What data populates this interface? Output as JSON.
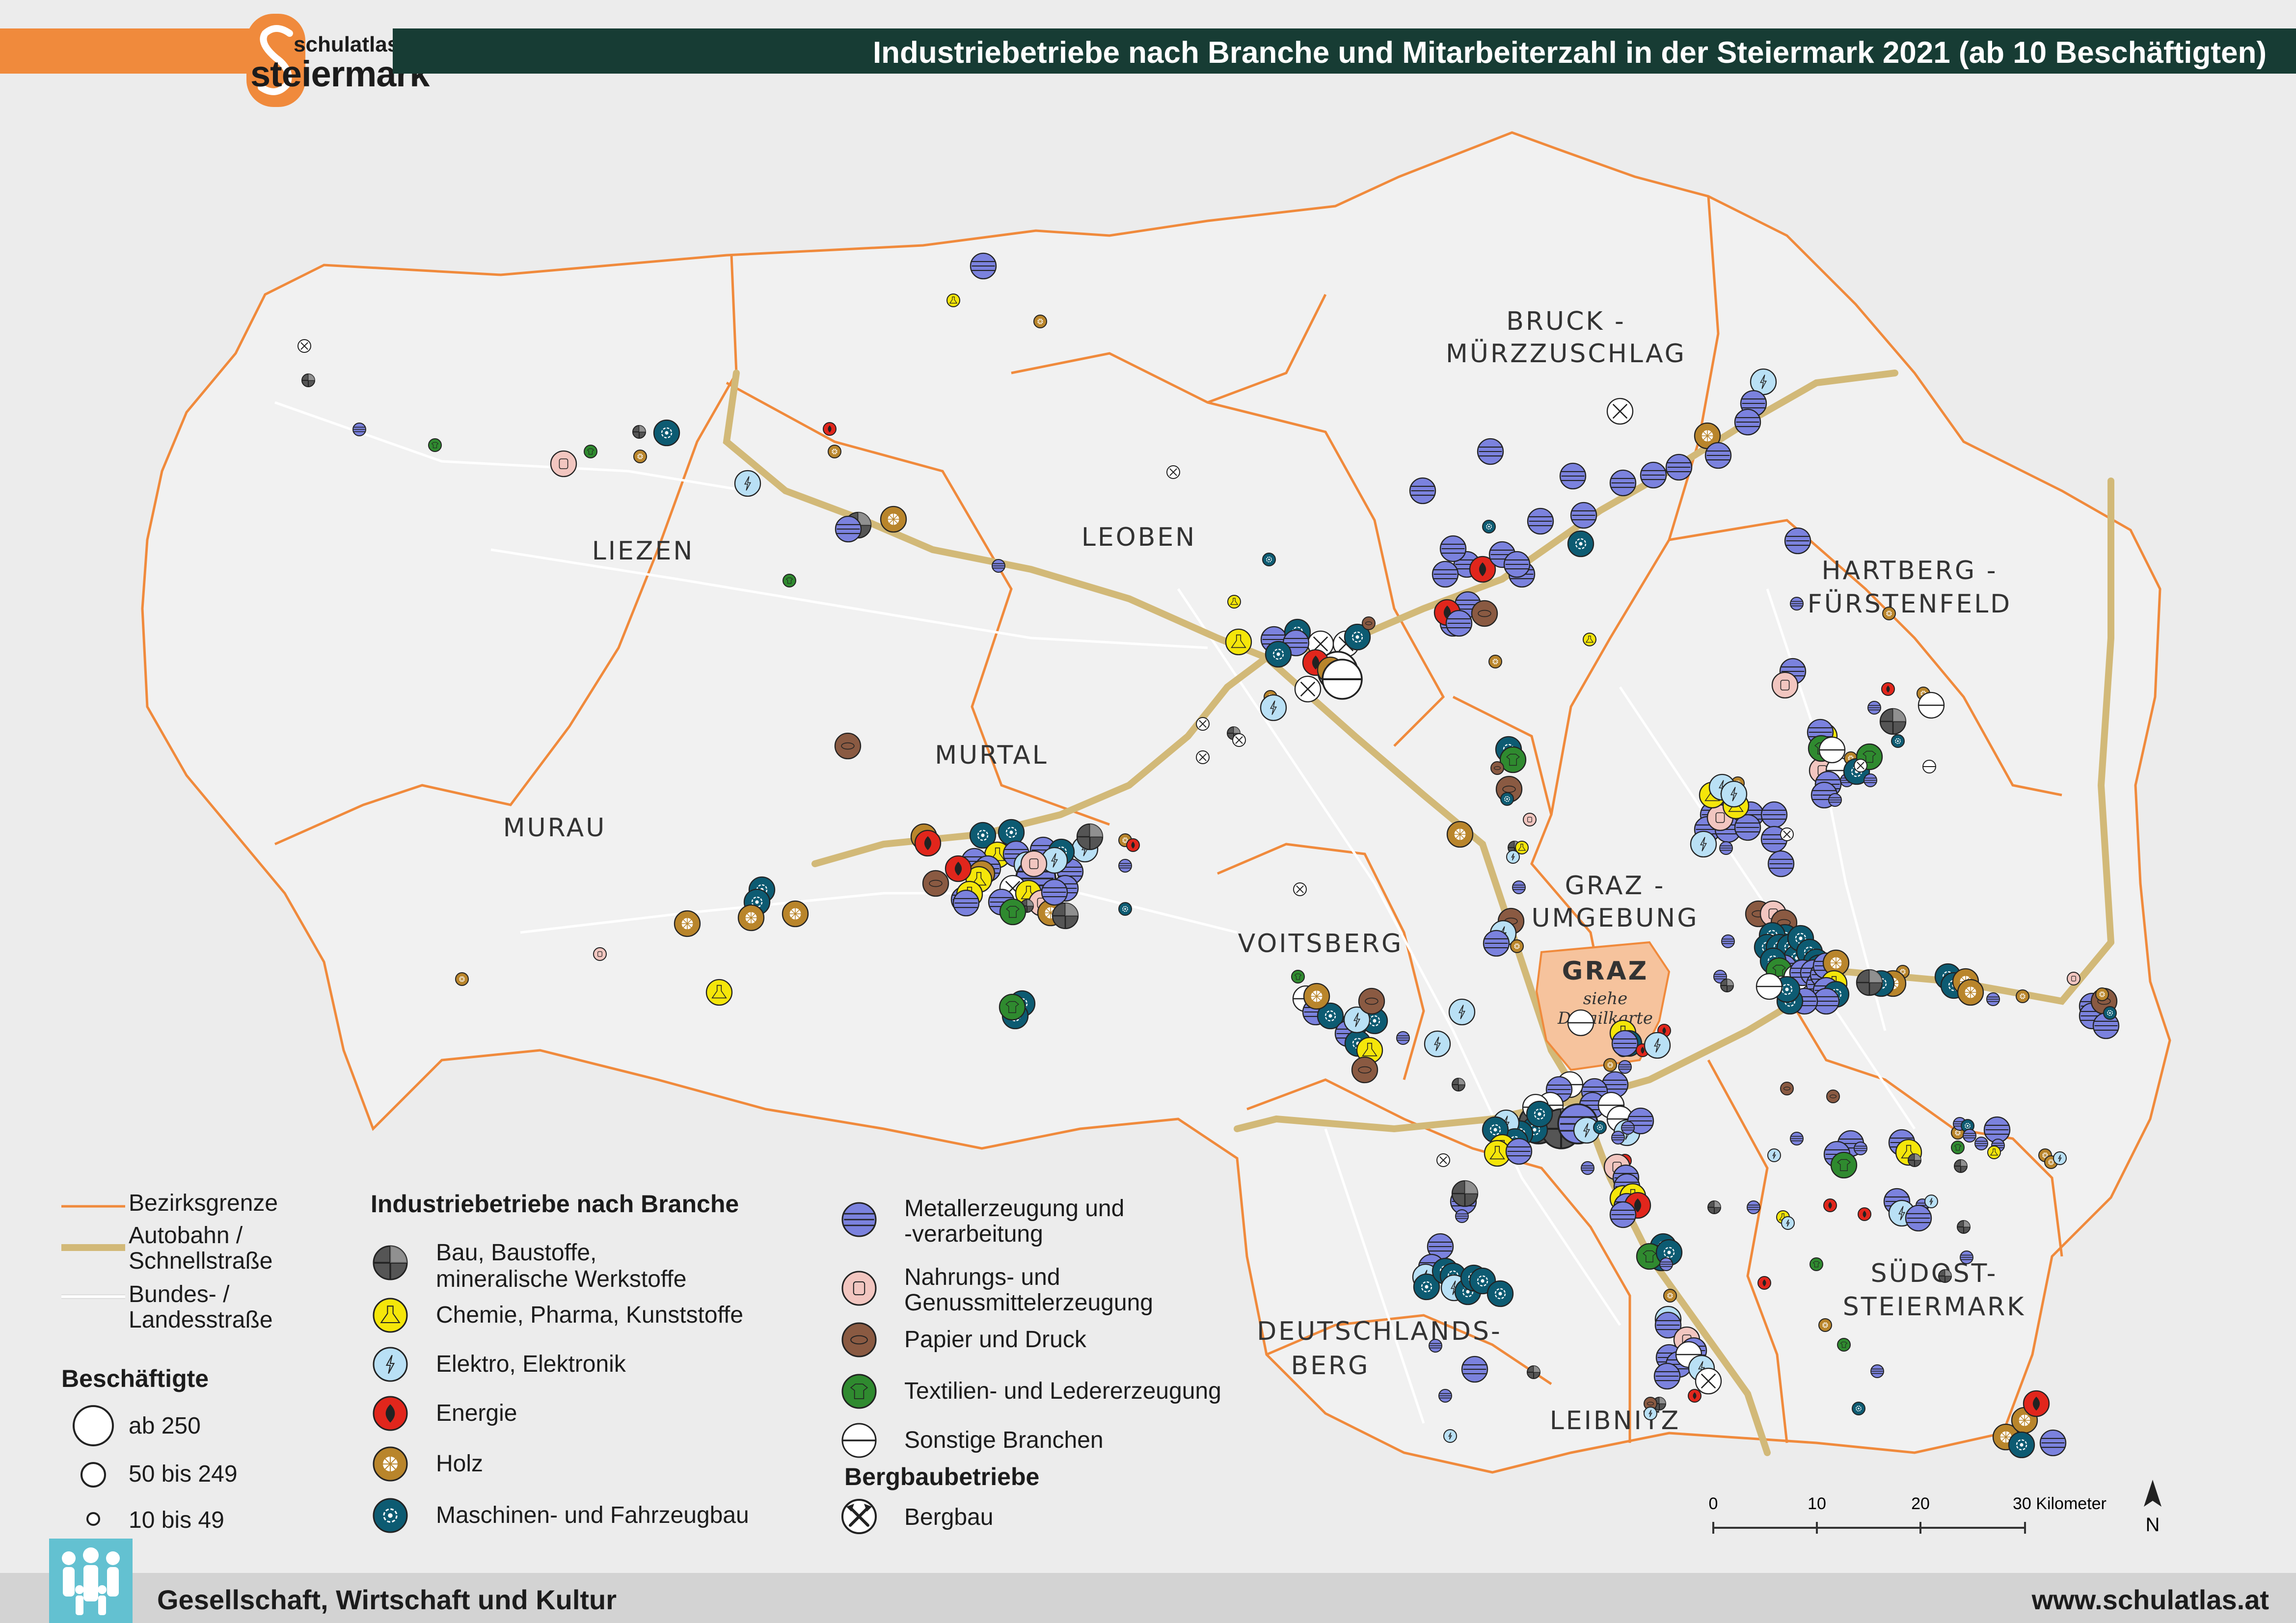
{
  "header": {
    "logo_top": "schulatlas",
    "logo_main": "steiermark",
    "title": "Industriebetriebe nach Branche und Mitarbeiterzahl in der Steiermark 2021 (ab 10 Beschäftigten)"
  },
  "colors": {
    "orange_accent": "#f08a3c",
    "title_bar": "#173c34",
    "district_border": "#f08a3c",
    "motorway": "#d2b978",
    "graz_area": "#f6c39d",
    "footer_bar": "#d3d3d3",
    "footer_icon": "#63c1d1"
  },
  "districts": [
    "LIEZEN",
    "LEOBEN",
    "BRUCK -",
    "MÜRZZUSCHLAG",
    "HARTBERG -",
    "FÜRSTENFELD",
    "MURTAL",
    "MURAU",
    "GRAZ -",
    "UMGEBUNG",
    "VOITSBERG",
    "DEUTSCHLANDS-",
    "BERG",
    "LEIBNITZ",
    "SÜDOST-",
    "STEIERMARK"
  ],
  "city": {
    "name": "GRAZ",
    "note_1": "siehe",
    "note_2": "Detailkarte"
  },
  "legend": {
    "lines": [
      {
        "label": "Bezirksgrenze",
        "style": "district-border"
      },
      {
        "label": "Autobahn /",
        "label2": "Schnellstraße",
        "style": "motorway"
      },
      {
        "label": "Bundes- /",
        "label2": "Landesstraße",
        "style": "road"
      }
    ],
    "size_title": "Beschäftigte",
    "sizes": [
      "ab 250",
      "50 bis 249",
      "10 bis 49"
    ],
    "branches_title": "Industriebetriebe nach Branche",
    "branches": [
      {
        "label": "Bau, Baustoffe,",
        "label2": "mineralische Werkstoffe",
        "color": "#555555",
        "icon": "cross-quarter-icon"
      },
      {
        "label": "Chemie, Pharma, Kunststoffe",
        "color": "#f5e60a",
        "icon": "flask-icon"
      },
      {
        "label": "Elektro, Elektronik",
        "color": "#b9e0f5",
        "icon": "lightning-icon"
      },
      {
        "label": "Energie",
        "color": "#e1261c",
        "icon": "flame-icon"
      },
      {
        "label": "Holz",
        "color": "#b9852b",
        "icon": "sawblade-icon"
      },
      {
        "label": "Maschinen- und Fahrzeugbau",
        "color": "#0d5b72",
        "icon": "gear-icon"
      },
      {
        "label": "Metallerzeugung und",
        "label2": "-verarbeitung",
        "color": "#7b82de",
        "icon": "metal-bars-icon"
      },
      {
        "label": "Nahrungs- und",
        "label2": "Genussmittelerzeugung",
        "color": "#f2c6c0",
        "icon": "can-icon"
      },
      {
        "label": "Papier und Druck",
        "color": "#8a5a42",
        "icon": "paper-roll-icon"
      },
      {
        "label": "Textilien- und Ledererzeugung",
        "color": "#2f8a2f",
        "icon": "shirt-icon"
      },
      {
        "label": "Sonstige Branchen",
        "color": "#ffffff",
        "icon": "line-icon"
      }
    ],
    "mining_title": "Bergbaubetriebe",
    "mining": {
      "label": "Bergbau",
      "icon": "hammers-icon"
    }
  },
  "scale": {
    "ticks": [
      "0",
      "10",
      "20",
      "30 Kilometer"
    ]
  },
  "north": "N",
  "footer": {
    "left": "Gesellschaft, Wirtschaft und Kultur",
    "right": "www.schulatlas.at"
  }
}
